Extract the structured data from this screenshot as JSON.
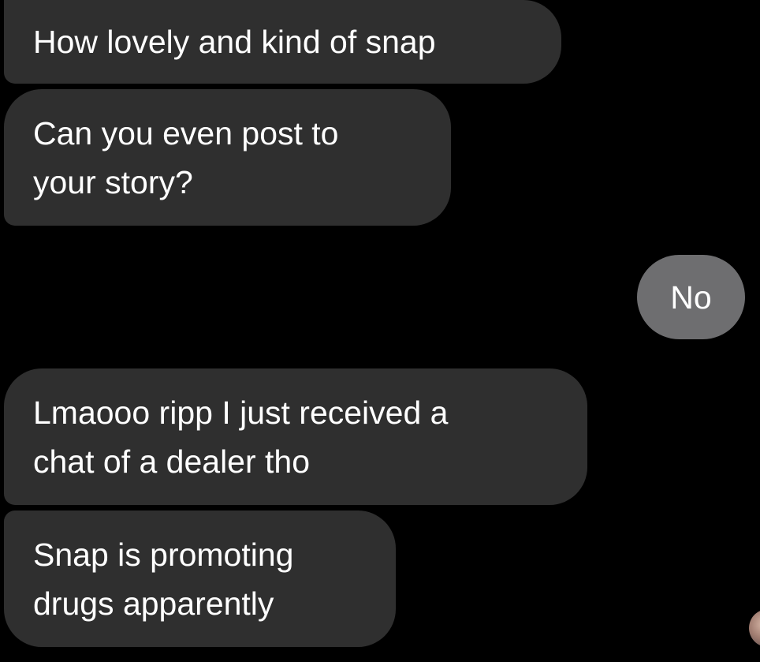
{
  "conversation": {
    "messages": [
      {
        "direction": "incoming",
        "text": "How lovely and kind of snap"
      },
      {
        "direction": "incoming",
        "text": "Can you even post to\nyour story?"
      },
      {
        "direction": "outgoing",
        "text": "No"
      },
      {
        "direction": "incoming",
        "text": "Lmaooo ripp I just received a\nchat of a dealer tho"
      },
      {
        "direction": "incoming",
        "text": "Snap is promoting\ndrugs apparently"
      }
    ]
  },
  "colors": {
    "background": "#000000",
    "incoming_bubble": "#2f2f2f",
    "outgoing_bubble": "#6e6e70",
    "text": "#ffffff"
  },
  "icons": {
    "sender_avatar": "contact-avatar-icon"
  }
}
